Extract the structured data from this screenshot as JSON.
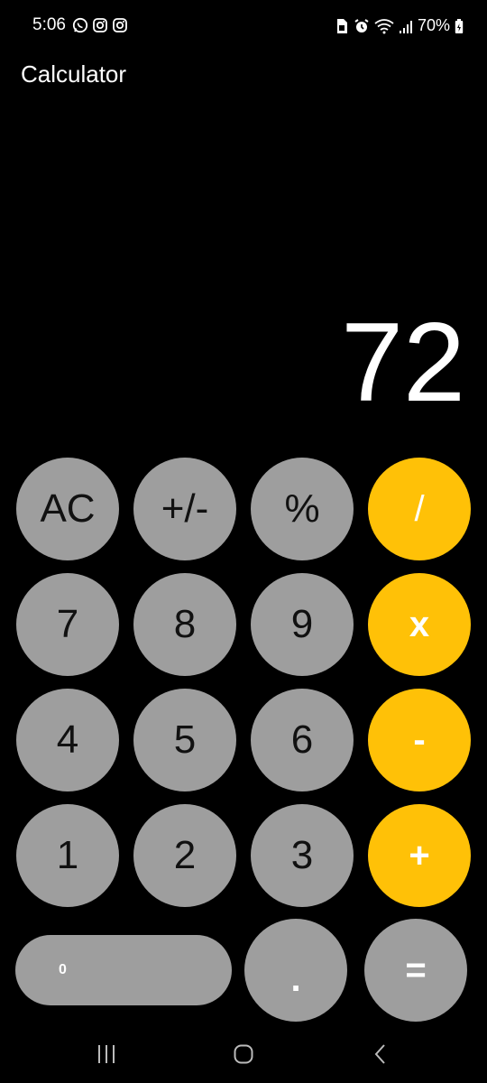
{
  "status_bar": {
    "time": "5:06",
    "left_icons": [
      "whatsapp-icon",
      "instagram-icon",
      "instagram-icon"
    ],
    "right_icons": [
      "sim-icon",
      "alarm-icon",
      "wifi-icon",
      "signal-icon",
      "battery-icon"
    ],
    "battery": "70%"
  },
  "app": {
    "title": "Calculator"
  },
  "display": {
    "value": "72"
  },
  "keys": {
    "ac": "AC",
    "sign": "+/-",
    "percent": "%",
    "divide": "/",
    "seven": "7",
    "eight": "8",
    "nine": "9",
    "multiply": "x",
    "four": "4",
    "five": "5",
    "six": "6",
    "minus": "-",
    "one": "1",
    "two": "2",
    "three": "3",
    "plus": "+",
    "zero": "0",
    "dot": ".",
    "equals": "="
  },
  "colors": {
    "background": "#000000",
    "number_key": "#9e9e9e",
    "operator_key": "#ffc107",
    "text": "#ffffff"
  },
  "nav_bar": {
    "buttons": [
      "recent-apps-icon",
      "home-icon",
      "back-icon"
    ]
  }
}
